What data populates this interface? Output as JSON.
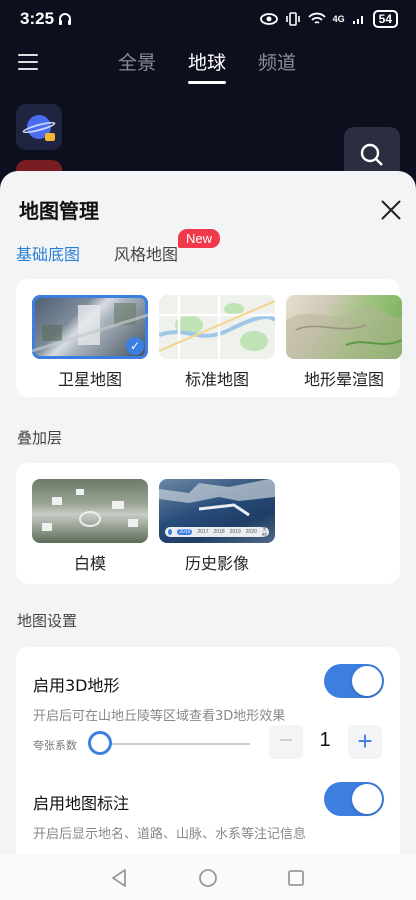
{
  "status_bar": {
    "time": "3:25",
    "network": "4G",
    "battery": "54"
  },
  "top_tabs": [
    {
      "label": "全景"
    },
    {
      "label": "地球"
    },
    {
      "label": "频道"
    }
  ],
  "sheet": {
    "title": "地图管理",
    "tabs": {
      "base": "基础底图",
      "style": "风格地图",
      "new_badge": "New"
    },
    "base_maps": [
      {
        "label": "卫星地图",
        "selected": true
      },
      {
        "label": "标准地图",
        "selected": false
      },
      {
        "label": "地形晕渲图",
        "selected": false
      }
    ],
    "overlay_section": "叠加层",
    "overlays": [
      {
        "label": "白模"
      },
      {
        "label": "历史影像",
        "years": [
          "2016",
          "2017",
          "2018",
          "2019",
          "2020",
          "全部"
        ]
      }
    ],
    "settings_section": "地图设置",
    "settings": {
      "terrain": {
        "title": "启用3D地形",
        "desc": "开启后可在山地丘陵等区域查看3D地形效果",
        "enabled": true,
        "scale_label": "夸张系数",
        "scale_value": "1",
        "minus": "−",
        "plus": "+"
      },
      "labels": {
        "title": "启用地图标注",
        "desc": "开启后显示地名、道路、山脉、水系等注记信息",
        "enabled": true
      }
    }
  },
  "colors": {
    "accent": "#3c7fe0",
    "badge": "#f1394c",
    "dark_bg": "#0d0f1f"
  }
}
